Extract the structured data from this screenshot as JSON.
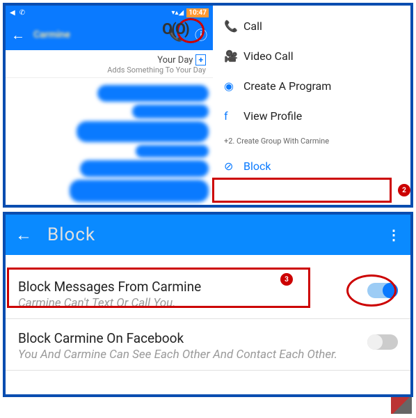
{
  "status_bar": {
    "time": "10:47",
    "signal": "▾▴◢"
  },
  "chat": {
    "contact": "Carmine",
    "your_day_title": "Your Day",
    "your_day_sub": "Adds Something To Your Day",
    "add_symbol": "+"
  },
  "overlay": "O(O)",
  "menu": {
    "call": "Call",
    "video_call": "Video Call",
    "create_program": "Create A Program",
    "view_profile": "View Profile",
    "create_group": "+2. Create Group With Carmine",
    "block": "Block"
  },
  "badges": {
    "b2": "2",
    "b3": "3"
  },
  "block_screen": {
    "header": "Block",
    "row1_title": "Block Messages From Carmine",
    "row1_desc": "Carmine Can't Text Or Call You.",
    "row2_title": "Block Carmine On Facebook",
    "row2_desc": "You And Carmine Can See Each Other And Contact Each Other."
  }
}
